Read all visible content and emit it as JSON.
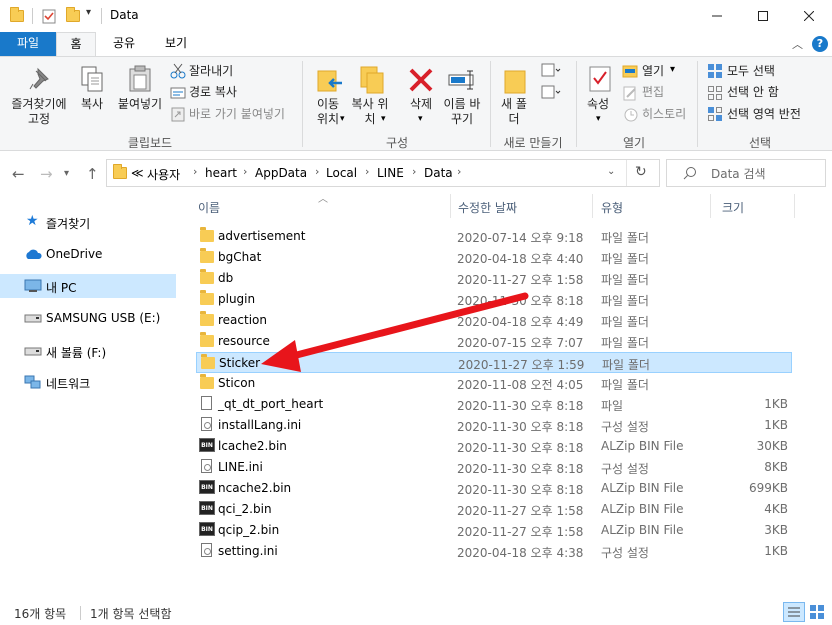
{
  "window": {
    "title": "Data"
  },
  "ribbon_tabs": [
    "파일",
    "홈",
    "공유",
    "보기"
  ],
  "ribbon": {
    "clipboard": {
      "pin": "즐겨찾기에 고정",
      "copy": "복사",
      "paste": "붙여넣기",
      "cut": "잘라내기",
      "copy_path": "경로 복사",
      "paste_shortcut": "바로 가기 붙여넣기",
      "group": "클립보드"
    },
    "organize": {
      "move_to": "이동 위치",
      "copy_to": "복사 위치",
      "delete": "삭제",
      "rename": "이름 바꾸기",
      "group": "구성"
    },
    "new": {
      "new_folder": "새 폴더",
      "group": "새로 만들기"
    },
    "open": {
      "properties": "속성",
      "open": "열기",
      "edit": "편집",
      "history": "히스토리",
      "group": "열기"
    },
    "select": {
      "select_all": "모두 선택",
      "select_none": "선택 안 함",
      "invert": "선택 영역 반전",
      "group": "선택"
    }
  },
  "breadcrumb": [
    "≪",
    "사용자",
    "heart",
    "AppData",
    "Local",
    "LINE",
    "Data"
  ],
  "search_placeholder": "Data 검색",
  "nav_pane": [
    "즐겨찾기",
    "OneDrive",
    "내 PC",
    "SAMSUNG USB (E:)",
    "새 볼륨 (F:)",
    "네트워크"
  ],
  "columns": [
    "이름",
    "수정한 날짜",
    "유형",
    "크기"
  ],
  "files": [
    {
      "name": "advertisement",
      "date": "2020-07-14 오후 9:18",
      "type": "파일 폴더",
      "size": "",
      "kind": "folder"
    },
    {
      "name": "bgChat",
      "date": "2020-04-18 오후 4:40",
      "type": "파일 폴더",
      "size": "",
      "kind": "folder"
    },
    {
      "name": "db",
      "date": "2020-11-27 오후 1:58",
      "type": "파일 폴더",
      "size": "",
      "kind": "folder"
    },
    {
      "name": "plugin",
      "date": "2020-11-30 오후 8:18",
      "type": "파일 폴더",
      "size": "",
      "kind": "folder"
    },
    {
      "name": "reaction",
      "date": "2020-04-18 오후 4:49",
      "type": "파일 폴더",
      "size": "",
      "kind": "folder"
    },
    {
      "name": "resource",
      "date": "2020-07-15 오후 7:07",
      "type": "파일 폴더",
      "size": "",
      "kind": "folder"
    },
    {
      "name": "Sticker",
      "date": "2020-11-27 오후 1:59",
      "type": "파일 폴더",
      "size": "",
      "kind": "folder",
      "selected": true
    },
    {
      "name": "Sticon",
      "date": "2020-11-08 오전 4:05",
      "type": "파일 폴더",
      "size": "",
      "kind": "folder"
    },
    {
      "name": "_qt_dt_port_heart",
      "date": "2020-11-30 오후 8:18",
      "type": "파일",
      "size": "1KB",
      "kind": "doc"
    },
    {
      "name": "installLang.ini",
      "date": "2020-11-30 오후 8:18",
      "type": "구성 설정",
      "size": "1KB",
      "kind": "ini"
    },
    {
      "name": "lcache2.bin",
      "date": "2020-11-30 오후 8:18",
      "type": "ALZip BIN File",
      "size": "30KB",
      "kind": "bin"
    },
    {
      "name": "LINE.ini",
      "date": "2020-11-30 오후 8:18",
      "type": "구성 설정",
      "size": "8KB",
      "kind": "ini"
    },
    {
      "name": "ncache2.bin",
      "date": "2020-11-30 오후 8:18",
      "type": "ALZip BIN File",
      "size": "699KB",
      "kind": "bin"
    },
    {
      "name": "qci_2.bin",
      "date": "2020-11-27 오후 1:58",
      "type": "ALZip BIN File",
      "size": "4KB",
      "kind": "bin"
    },
    {
      "name": "qcip_2.bin",
      "date": "2020-11-27 오후 1:58",
      "type": "ALZip BIN File",
      "size": "3KB",
      "kind": "bin"
    },
    {
      "name": "setting.ini",
      "date": "2020-04-18 오후 4:38",
      "type": "구성 설정",
      "size": "1KB",
      "kind": "ini"
    }
  ],
  "bin_icon_text": "BIN",
  "status": {
    "count": "16개 항목",
    "selected": "1개 항목 선택함"
  },
  "colors": {
    "accent": "#1979ca",
    "selection": "#cce8ff",
    "arrow": "#e8151b"
  }
}
